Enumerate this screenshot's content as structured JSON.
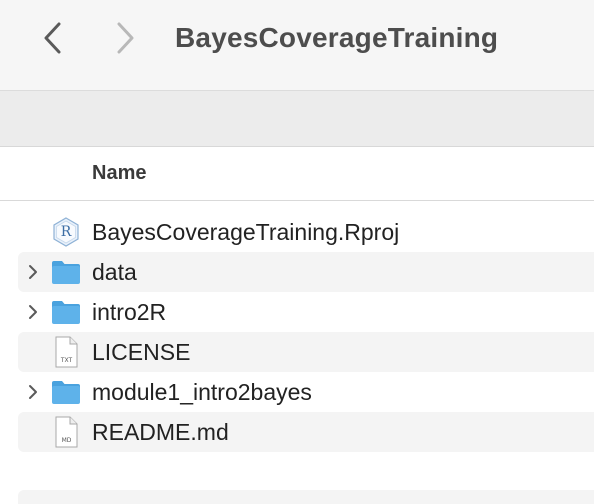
{
  "window": {
    "title": "BayesCoverageTraining"
  },
  "nav": {
    "back_icon": "chevron-left-icon",
    "forward_icon": "chevron-right-icon"
  },
  "columns": {
    "name_label": "Name"
  },
  "files": [
    {
      "name": "BayesCoverageTraining.Rproj",
      "kind": "rproj",
      "icon": "r-project-icon",
      "expandable": false,
      "badge": "R"
    },
    {
      "name": "data",
      "kind": "folder",
      "icon": "folder-icon",
      "expandable": true
    },
    {
      "name": "intro2R",
      "kind": "folder",
      "icon": "folder-icon",
      "expandable": true
    },
    {
      "name": "LICENSE",
      "kind": "text",
      "icon": "text-file-icon",
      "expandable": false,
      "badge": "TXT"
    },
    {
      "name": "module1_intro2bayes",
      "kind": "folder",
      "icon": "folder-icon",
      "expandable": true
    },
    {
      "name": "README.md",
      "kind": "markdown",
      "icon": "markdown-file-icon",
      "expandable": false,
      "badge": "MD"
    }
  ],
  "colors": {
    "folder": "#5eb2ea",
    "folder_tab": "#4aa2de",
    "chevron": "#5a5a5a",
    "nav_active": "#5a5a5a",
    "nav_disabled": "#b8b8b8"
  }
}
